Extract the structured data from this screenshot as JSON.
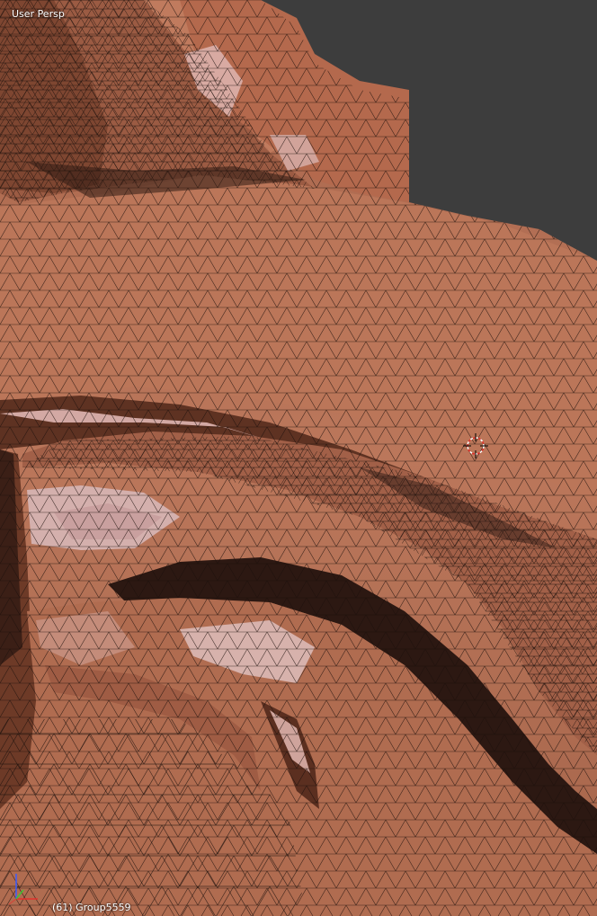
{
  "viewport": {
    "view_label": "User Persp",
    "object_info": "(61) Group5559"
  },
  "colors": {
    "background": "#3d3d3d",
    "mesh_base": "#b87358",
    "mesh_dark": "#6e3a28",
    "mesh_shadow": "#2b1a14",
    "mesh_highlight": "#d9a7a0",
    "wire": "#1a0f0b"
  },
  "icons": {
    "cursor": "3d-cursor-icon",
    "axes": "axis-gizmo-icon"
  }
}
